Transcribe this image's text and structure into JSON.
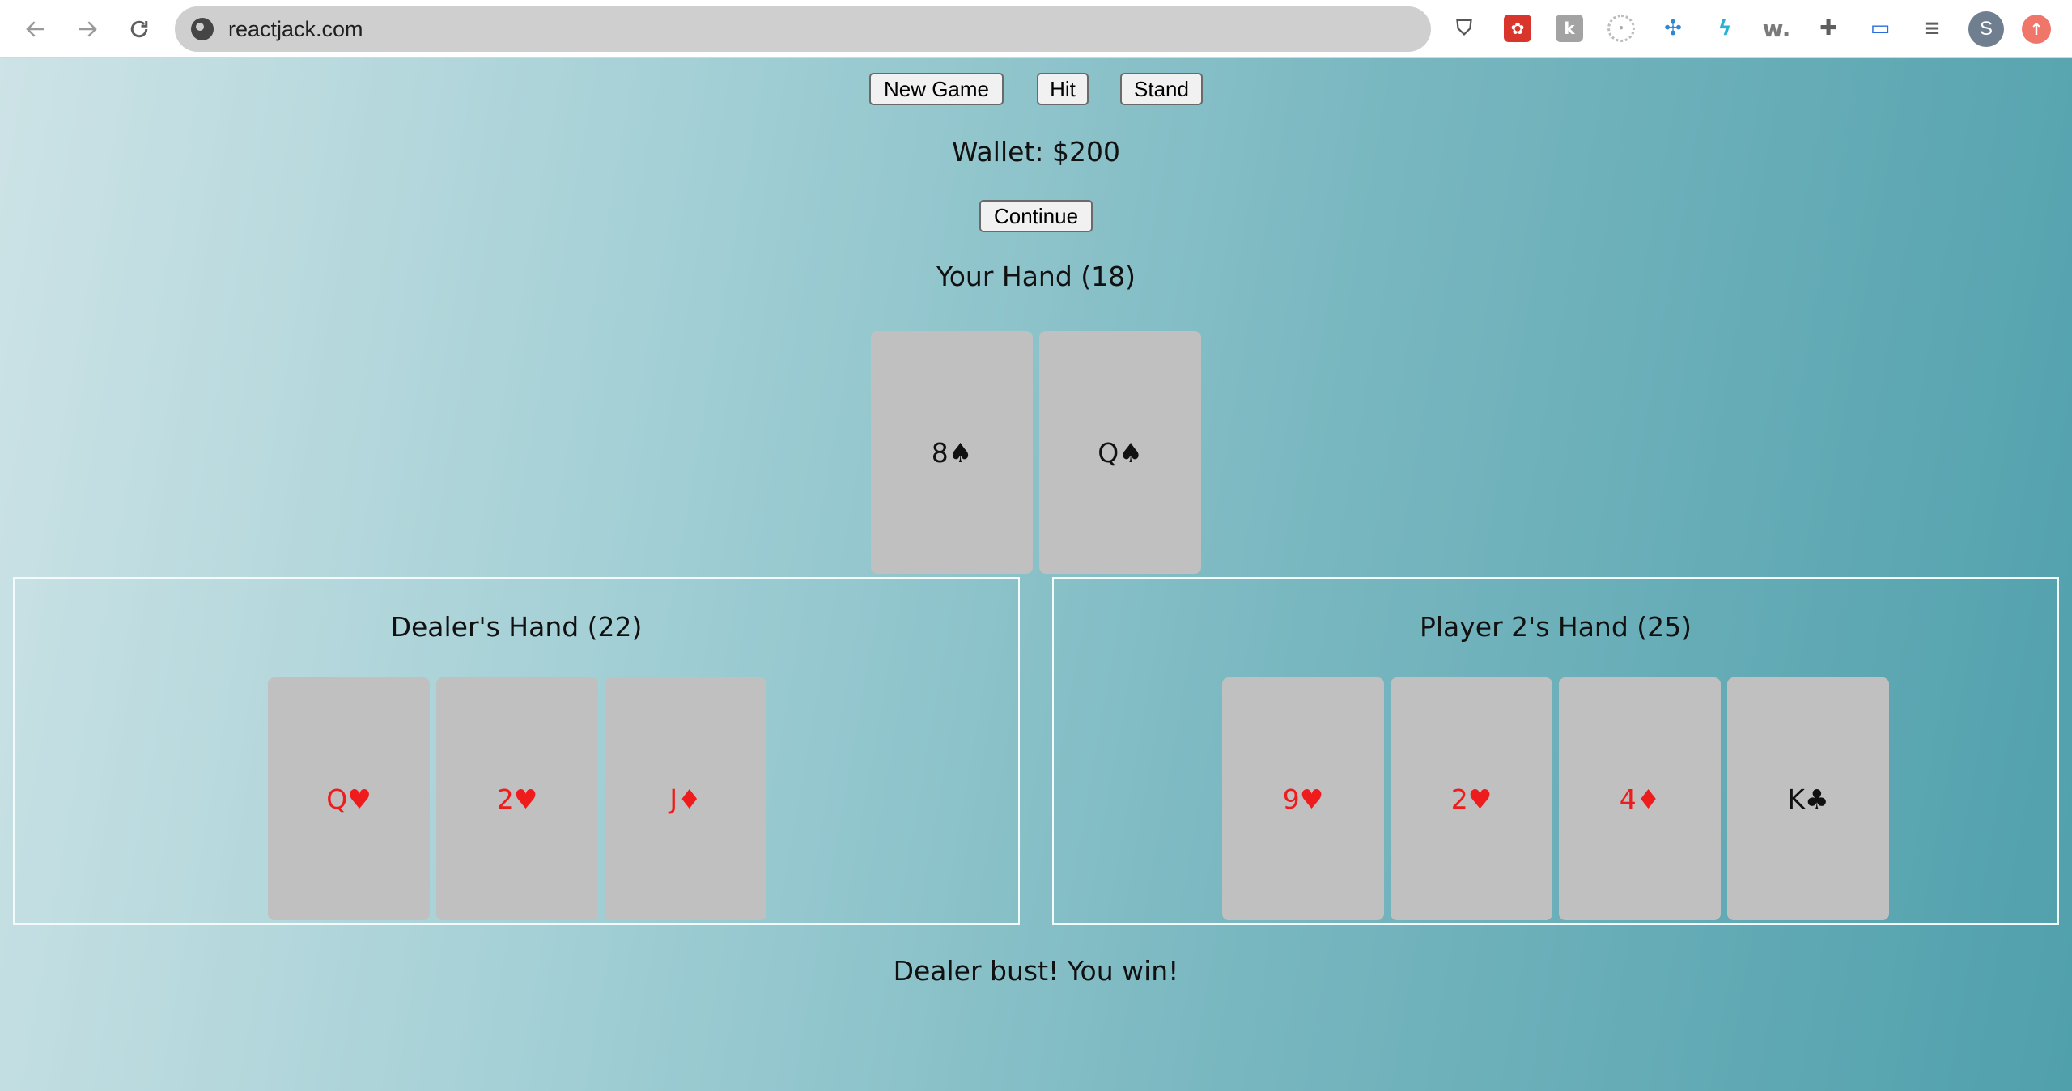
{
  "browser": {
    "url": "reactjack.com",
    "profile_initial": "S",
    "extensions": [
      "shield-icon",
      "paw-icon",
      "k-icon",
      "circle-icon",
      "pinwheel-icon",
      "bolt-icon",
      "w-icon",
      "puzzle-icon",
      "cast-icon",
      "queue-icon"
    ]
  },
  "controls": {
    "new_game": "New Game",
    "hit": "Hit",
    "stand": "Stand",
    "continue": "Continue"
  },
  "wallet": "Wallet: $200",
  "your_hand": {
    "title": "Your Hand (18)",
    "cards": [
      "8♠",
      "Q♠"
    ]
  },
  "dealer_hand": {
    "title": "Dealer's Hand (22)",
    "cards": [
      "Q♥",
      "2♥",
      "J♦"
    ]
  },
  "player2_hand": {
    "title": "Player 2's Hand (25)",
    "cards": [
      "9♥",
      "2♥",
      "4♦",
      "K♣"
    ]
  },
  "result": "Dealer bust! You win!",
  "colors": {
    "red_suit": "#ee1c1c",
    "black_suit": "#111111",
    "card_bg": "#c0c0c0"
  }
}
